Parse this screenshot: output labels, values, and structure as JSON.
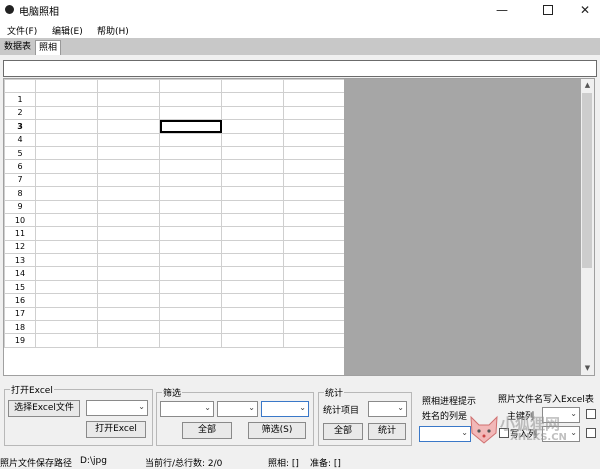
{
  "window": {
    "title": "电脑照相"
  },
  "menu": [
    "文件(F)",
    "编辑(E)",
    "帮助(H)"
  ],
  "tabs": [
    "数据表",
    "照相"
  ],
  "grid": {
    "rows": [
      "1",
      "2",
      "3",
      "4",
      "5",
      "6",
      "7",
      "8",
      "9",
      "10",
      "11",
      "12",
      "13",
      "14",
      "15",
      "16",
      "17",
      "18",
      "19"
    ],
    "column_count": 5,
    "selected": {
      "row": 3,
      "col": 3
    }
  },
  "open_excel": {
    "title": "打开Excel",
    "select_btn": "选择Excel文件",
    "open_btn": "打开Excel"
  },
  "filter": {
    "title": "筛选",
    "all_btn": "全部",
    "filter_btn": "筛选(S)"
  },
  "stats": {
    "title": "统计",
    "item_label": "统计项目",
    "all_btn": "全部",
    "stat_btn": "统计"
  },
  "progress": {
    "title": "照相进程提示",
    "name_col_label": "姓名的列是"
  },
  "write": {
    "title": "照片文件名写入Excel表",
    "key_col_label": "主键列",
    "write_col_label": "写入列"
  },
  "status": {
    "save_path_label": "照片文件保存路径",
    "save_path_value": "D:\\jpg",
    "row_info": "当前行/总行数: 2/0",
    "photo": "照相: []",
    "ready": "准备: []"
  },
  "watermark": {
    "cn": "小狐狸网",
    "en": "XHLKS.CN"
  }
}
